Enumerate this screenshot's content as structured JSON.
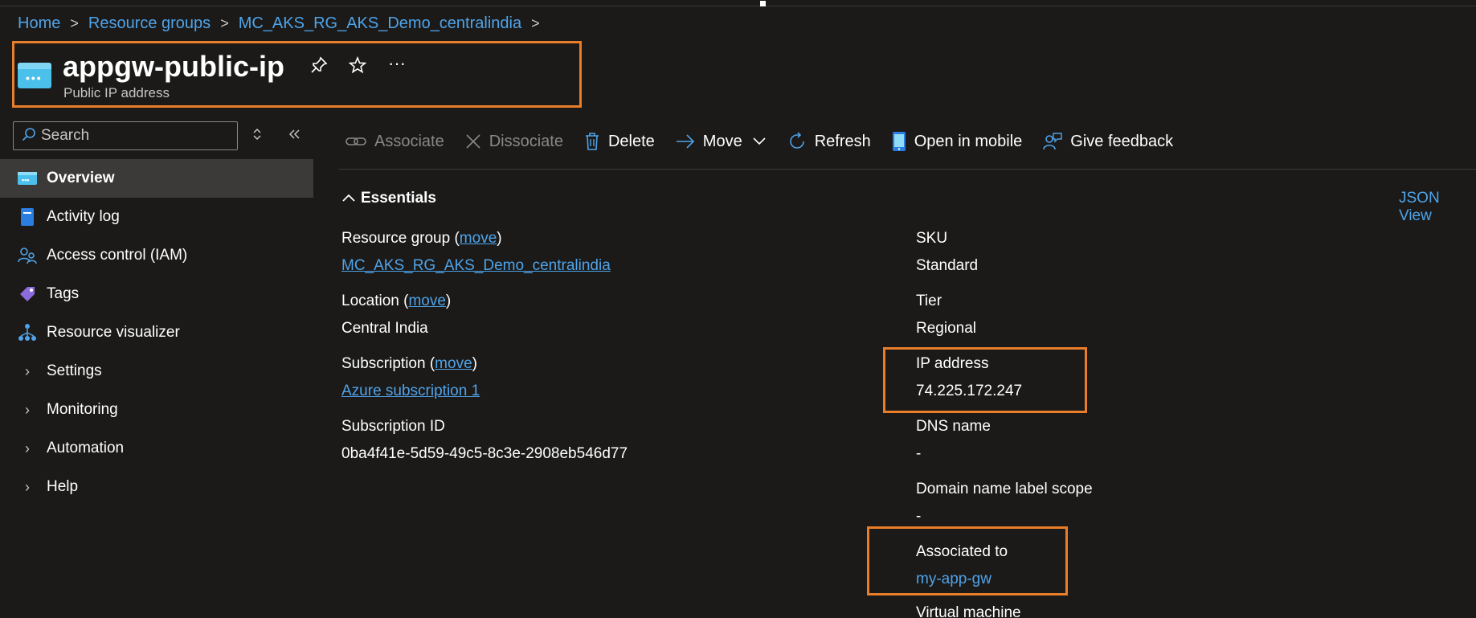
{
  "breadcrumb": {
    "items": [
      "Home",
      "Resource groups",
      "MC_AKS_RG_AKS_Demo_centralindia"
    ],
    "separator": ">"
  },
  "header": {
    "title": "appgw-public-ip",
    "subtitle": "Public IP address",
    "more": "···"
  },
  "search": {
    "placeholder": "Search"
  },
  "nav": {
    "items": [
      {
        "label": "Overview",
        "icon": "overview-icon"
      },
      {
        "label": "Activity log",
        "icon": "activity-log-icon"
      },
      {
        "label": "Access control (IAM)",
        "icon": "iam-icon"
      },
      {
        "label": "Tags",
        "icon": "tag-icon"
      },
      {
        "label": "Resource visualizer",
        "icon": "visualizer-icon"
      },
      {
        "label": "Settings",
        "icon": "chevron-right-icon"
      },
      {
        "label": "Monitoring",
        "icon": "chevron-right-icon"
      },
      {
        "label": "Automation",
        "icon": "chevron-right-icon"
      },
      {
        "label": "Help",
        "icon": "chevron-right-icon"
      }
    ]
  },
  "toolbar": {
    "associate": "Associate",
    "dissociate": "Dissociate",
    "delete": "Delete",
    "move": "Move",
    "refresh": "Refresh",
    "open_mobile": "Open in mobile",
    "feedback": "Give feedback"
  },
  "essentials": {
    "title": "Essentials",
    "json_view": "JSON View",
    "left": {
      "resource_group_label": "Resource group (",
      "resource_group_move": "move",
      "resource_group_close": ")",
      "resource_group_value": "MC_AKS_RG_AKS_Demo_centralindia",
      "location_label": "Location (",
      "location_move": "move",
      "location_close": ")",
      "location_value": "Central India",
      "subscription_label": "Subscription (",
      "subscription_move": "move",
      "subscription_close": ")",
      "subscription_value": "Azure subscription 1",
      "subscription_id_label": "Subscription ID",
      "subscription_id_value": "0ba4f41e-5d59-49c5-8c3e-2908eb546d77"
    },
    "right": {
      "sku_label": "SKU",
      "sku_value": "Standard",
      "tier_label": "Tier",
      "tier_value": "Regional",
      "ip_label": "IP address",
      "ip_value": "74.225.172.247",
      "dns_label": "DNS name",
      "dns_value": "-",
      "scope_label": "Domain name label scope",
      "scope_value": "-",
      "assoc_label": "Associated to",
      "assoc_value": "my-app-gw",
      "vm_label": "Virtual machine"
    }
  },
  "colors": {
    "background": "#1b1a19",
    "accent_link": "#4fa3e8",
    "highlight": "#e87d2a",
    "active_nav": "#3b3a39"
  }
}
